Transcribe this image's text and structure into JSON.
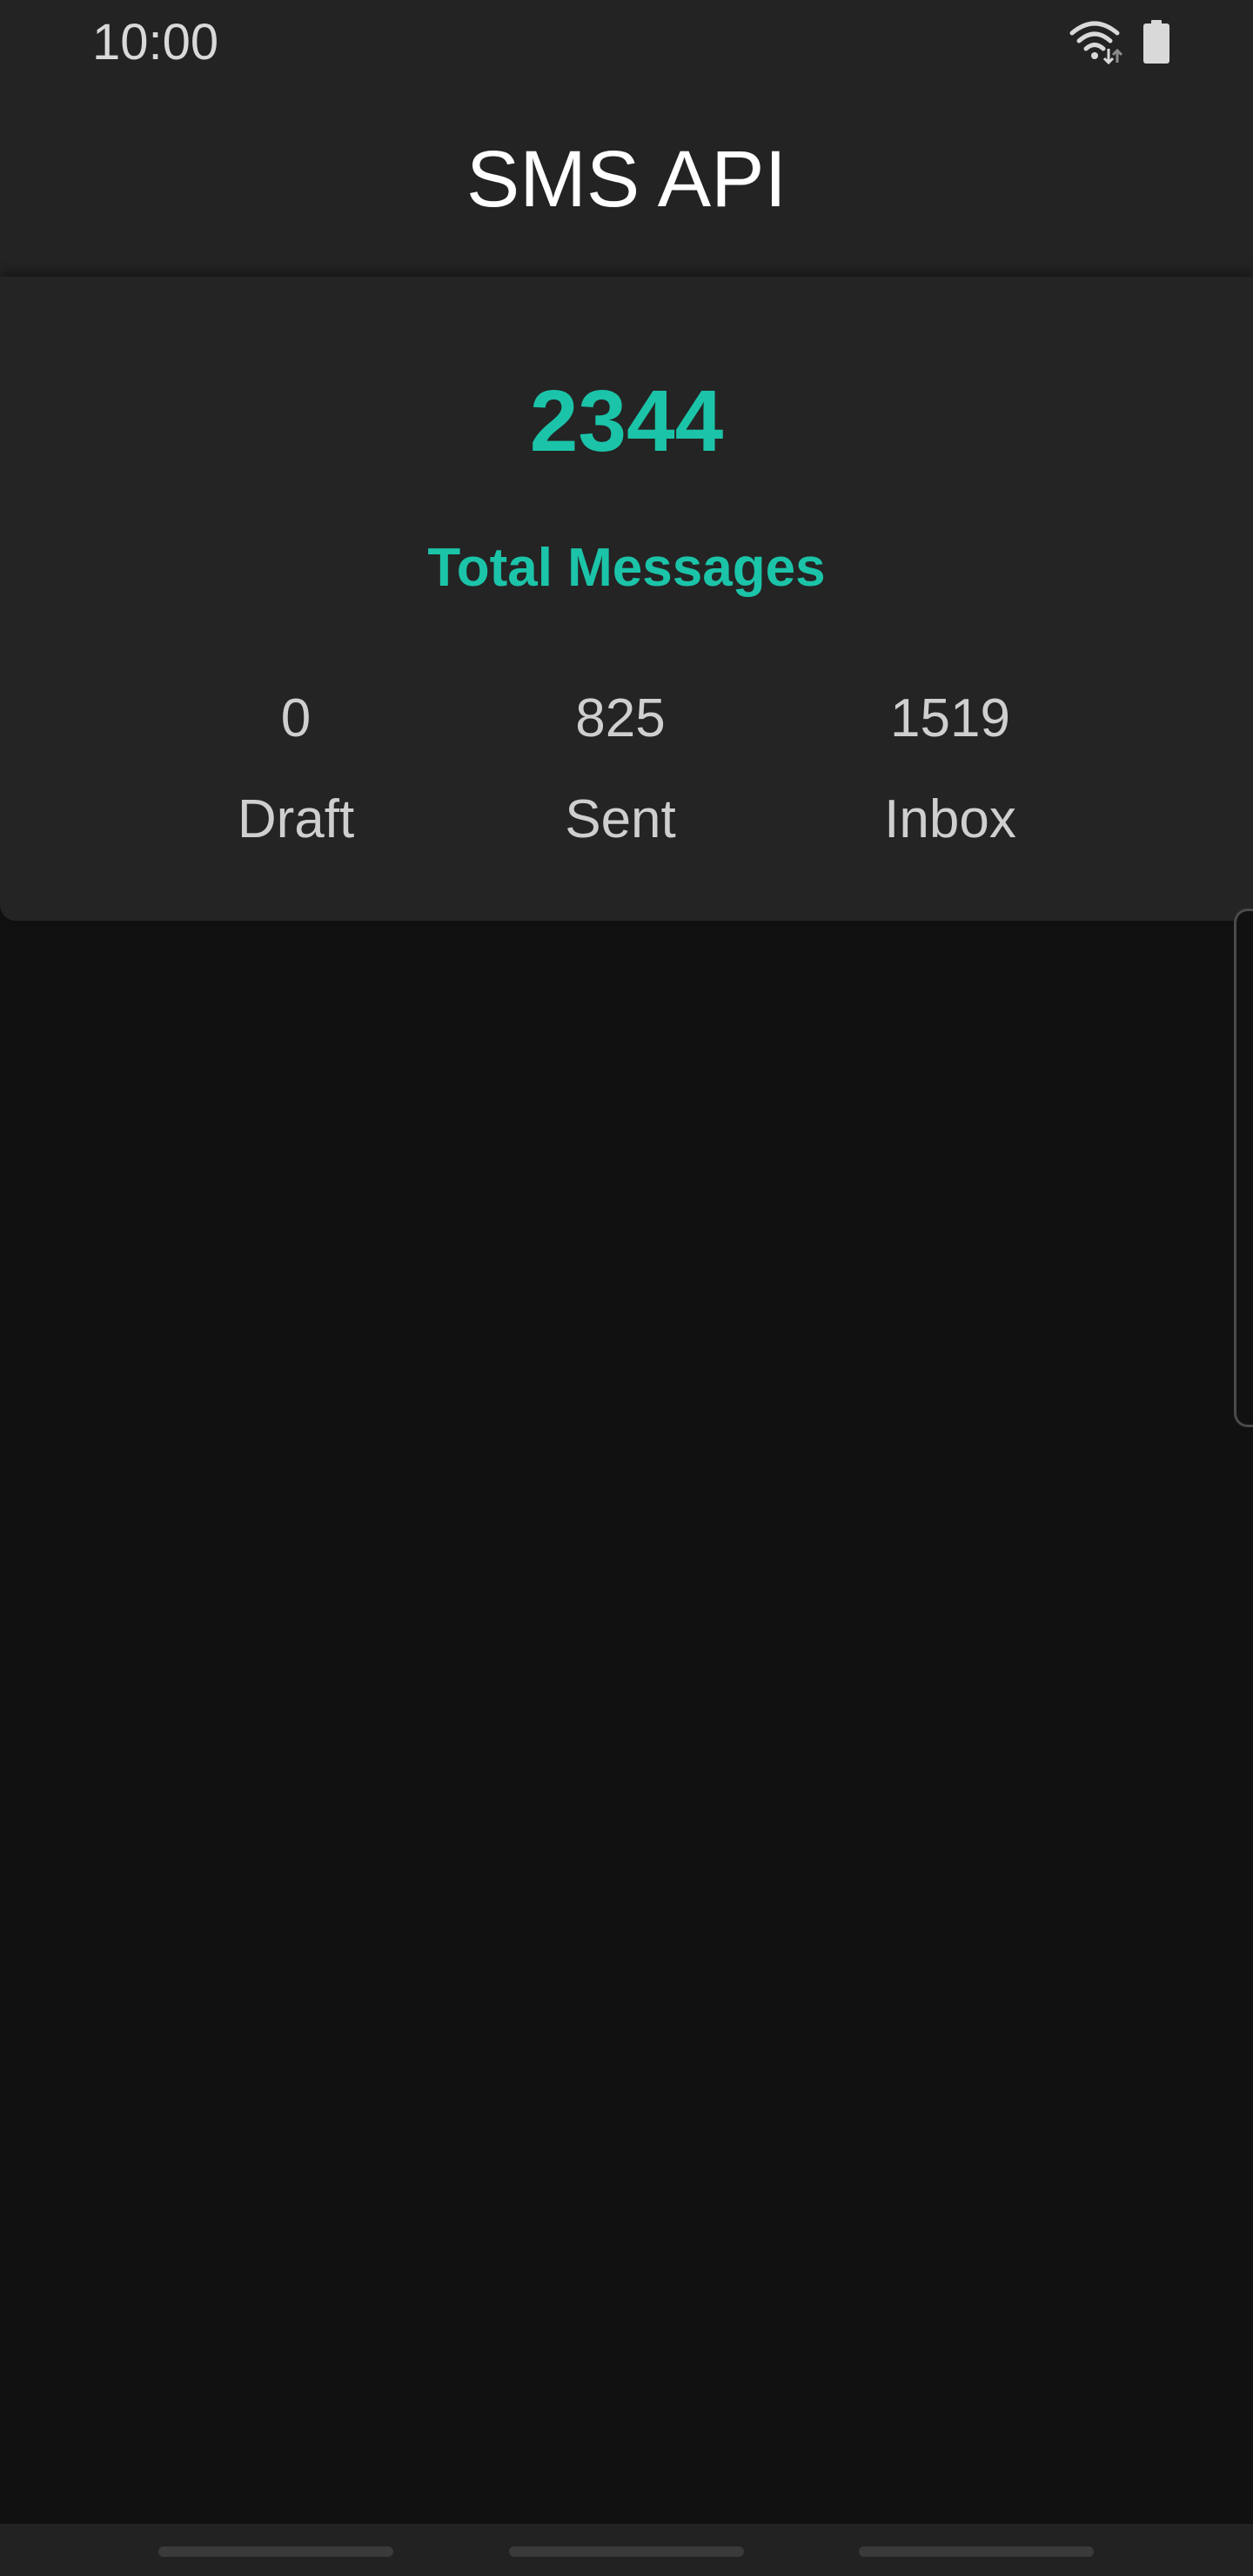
{
  "status_bar": {
    "time": "10:00",
    "icons": [
      "wifi-icon",
      "battery-icon"
    ]
  },
  "app_bar": {
    "title": "SMS API"
  },
  "summary": {
    "total_count": "2344",
    "total_label": "Total Messages",
    "stats": [
      {
        "value": "0",
        "label": "Draft"
      },
      {
        "value": "825",
        "label": "Sent"
      },
      {
        "value": "1519",
        "label": "Inbox"
      }
    ]
  },
  "colors": {
    "accent": "#1bc4a8",
    "background": "#111111",
    "surface": "#232323",
    "text_primary": "#ffffff",
    "text_secondary": "#cfcfcf"
  }
}
